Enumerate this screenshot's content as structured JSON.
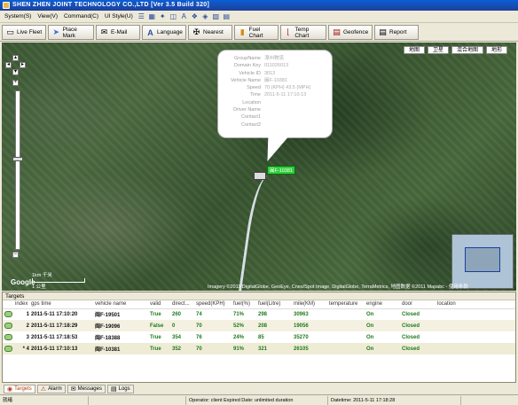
{
  "window": {
    "title": "SHEN ZHEN JOINT TECHNOLOGY CO.,LTD [Ver 3.5  Build 320]"
  },
  "menu": {
    "items": [
      "System(S)",
      "View(V)",
      "Command(C)",
      "UI Style(U)"
    ]
  },
  "toolbar": {
    "buttons": [
      "Live Fleet",
      "Place Mark",
      "E-Mail",
      "Language",
      "Nearest",
      "Fuel Chart",
      "Temp Chart",
      "Geofence",
      "Report"
    ]
  },
  "map": {
    "map_types": [
      "地图",
      "卫星",
      "混合地图",
      "地形"
    ],
    "vehicle_label": "闽F-10381",
    "scale_top": "1km  千米",
    "scale_bottom": "1 公里",
    "logo": "Google",
    "copyright": "Imagery ©2011 DigitalGlobe, GeoEye, Cnes/Spot Image, DigitalGlobe, TerraMetrics, 地图数据 ©2011 Mapabc - 使用条款",
    "popup": [
      {
        "k": "GroupName",
        "v": "漳州物流"
      },
      {
        "k": "Domain Key",
        "v": "011026013"
      },
      {
        "k": "Vehicle ID",
        "v": "3013"
      },
      {
        "k": "Vehicle Name",
        "v": "闽F-10381"
      },
      {
        "k": "Speed",
        "v": "70 (KPH) 43.5 (MPH)"
      },
      {
        "k": "Time",
        "v": "2011-5-11 17:10:13"
      },
      {
        "k": "Location",
        "v": ""
      },
      {
        "k": "Driver Name",
        "v": ""
      },
      {
        "k": "Contact1",
        "v": ""
      },
      {
        "k": "Contact2",
        "v": ""
      }
    ]
  },
  "targets": {
    "title": "Targets",
    "columns": [
      "index",
      "gps time",
      "vehicle name",
      "valid",
      "direct...",
      "speed(KPH)",
      "fuel(%)",
      "fuel(Litre)",
      "mile(KM)",
      "temperature",
      "engine",
      "door",
      "location"
    ],
    "rows": [
      [
        "1",
        "2011-5-11 17:10:20",
        "闽F-19501",
        "True",
        "260",
        "74",
        "71%",
        "298",
        "30963",
        "",
        "On",
        "Closed",
        ""
      ],
      [
        "2",
        "2011-5-11 17:18:29",
        "闽F-19096",
        "False",
        "0",
        "70",
        "52%",
        "208",
        "19056",
        "",
        "On",
        "Closed",
        ""
      ],
      [
        "3",
        "2011-5-11 17:18:53",
        "闽F-18388",
        "True",
        "354",
        "76",
        "24%",
        "85",
        "35270",
        "",
        "On",
        "Closed",
        ""
      ],
      [
        "* 4",
        "2011-5-11 17:10:13",
        "闽F-10381",
        "True",
        "352",
        "70",
        "91%",
        "321",
        "26105",
        "",
        "On",
        "Closed",
        ""
      ]
    ]
  },
  "tabs": [
    "Targets",
    "Alarm",
    "Messages",
    "Logs"
  ],
  "status": {
    "cells": [
      "就绪",
      "",
      "Operator: client  Expired Date: unlimited duration",
      "Datetime: 2011-5-11 17:18:28",
      ""
    ]
  }
}
